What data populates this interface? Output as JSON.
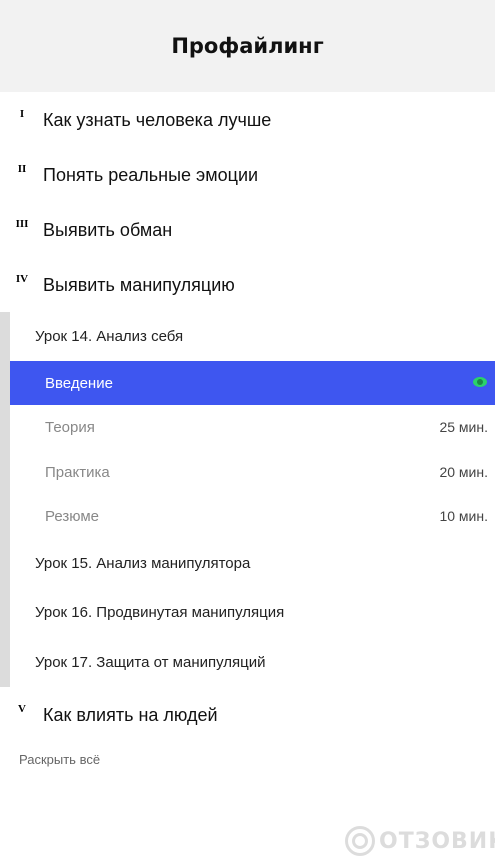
{
  "header": {
    "title": "Профайлинг"
  },
  "modules": [
    {
      "num": "I",
      "title": "Как узнать человека лучше"
    },
    {
      "num": "II",
      "title": "Понять реальные эмоции"
    },
    {
      "num": "III",
      "title": "Выявить обман"
    },
    {
      "num": "IV",
      "title": "Выявить манипуляцию"
    },
    {
      "num": "V",
      "title": "Как влиять на людей"
    }
  ],
  "lessons": [
    "Урок 14. Анализ себя",
    "Урок 15. Анализ манипулятора",
    "Урок 16. Продвинутая манипуляция",
    "Урок 17. Защита от манипуляций"
  ],
  "steps": [
    {
      "label": "Введение",
      "duration": "",
      "icon": "eye-icon",
      "active": true
    },
    {
      "label": "Теория",
      "duration": "25 мин."
    },
    {
      "label": "Практика",
      "duration": "20 мин."
    },
    {
      "label": "Резюме",
      "duration": "10 мин."
    }
  ],
  "expand_all": "Раскрыть всё",
  "watermark": {
    "text": "ОТЗОВИК"
  },
  "colors": {
    "active_bg": "#3e56f0",
    "eye": "#2bd16a",
    "header_bg": "#f2f2f2"
  }
}
